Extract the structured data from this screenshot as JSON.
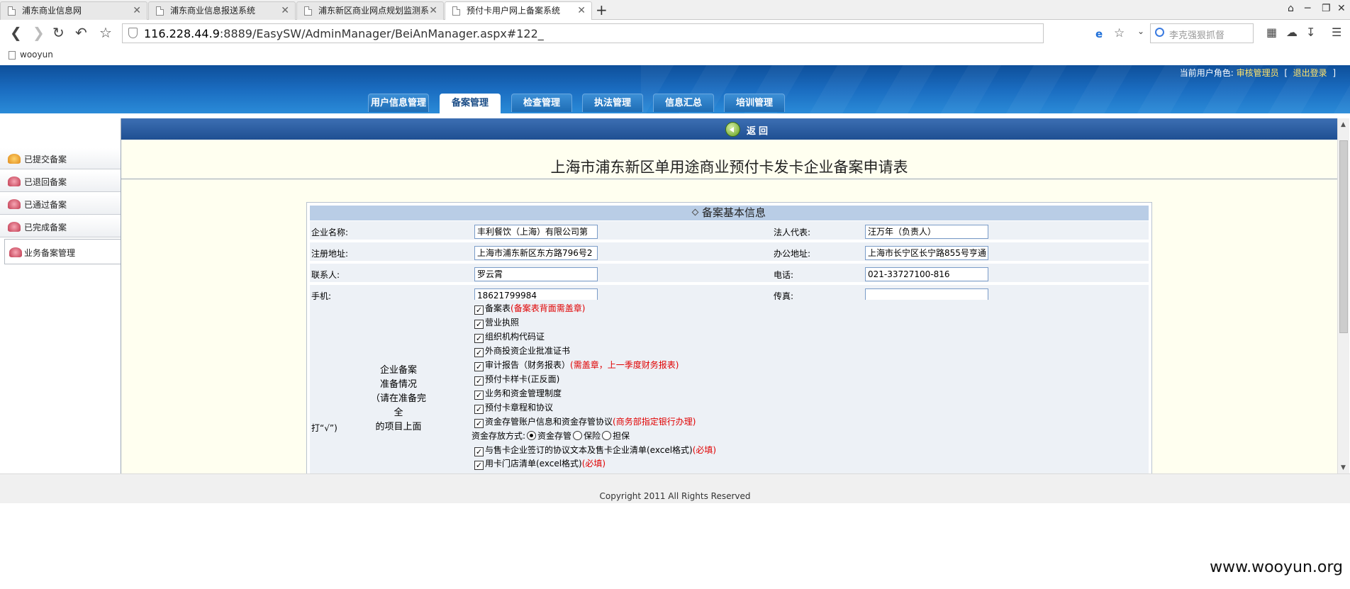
{
  "browser": {
    "tabs": [
      {
        "title": "浦东商业信息网"
      },
      {
        "title": "浦东商业信息报送系统"
      },
      {
        "title": "浦东新区商业网点规划监测系"
      },
      {
        "title": "预付卡用户网上备案系统"
      }
    ],
    "new_tab": "+",
    "url_host": "116.228.44.9",
    "url_rest": ":8889/EasySW/AdminManager/BeiAnManager.aspx#122_",
    "search_placeholder": "李克强狠抓督",
    "bookmark": "wooyun",
    "window_controls": [
      "❯",
      "─",
      "❐",
      "✕"
    ]
  },
  "header": {
    "user_prefix": "当前用户角色:",
    "role": "审核管理员",
    "bracket_open": "[",
    "logout": "退出登录",
    "bracket_close": "]",
    "menu": [
      {
        "label": "用户信息管理"
      },
      {
        "label": "备案管理"
      },
      {
        "label": "检查管理"
      },
      {
        "label": "执法管理"
      },
      {
        "label": "信息汇总"
      },
      {
        "label": "培训管理"
      }
    ]
  },
  "sidebar": {
    "items": [
      {
        "label": "已提交备案"
      },
      {
        "label": "已退回备案"
      },
      {
        "label": "已通过备案"
      },
      {
        "label": "已完成备案"
      },
      {
        "label": "业务备案管理"
      }
    ]
  },
  "main": {
    "back_label": "返回",
    "title": "上海市浦东新区单用途商业预付卡发卡企业备案申请表",
    "section_title": "备案基本信息",
    "fields": {
      "company_label": "企业名称:",
      "company_value": "丰利餐饮（上海）有限公司第",
      "legal_label": "法人代表:",
      "legal_value": "汪万年（负责人）",
      "reg_addr_label": "注册地址:",
      "reg_addr_value": "上海市浦东新区东方路796号2",
      "office_label": "办公地址:",
      "office_value": "上海市长宁区长宁路855号亨通",
      "contact_label": "联系人:",
      "contact_value": "罗云霄",
      "phone_label": "电话:",
      "phone_value": "021-33727100-816",
      "mobile_label": "手机:",
      "mobile_value": "18621799984",
      "fax_label": "传真:",
      "fax_value": ""
    },
    "prep": {
      "label": "企业备案\n准备情况\n（请在准备完全\n的项目上面",
      "tick_hint": "打“√”)",
      "items": [
        {
          "text": "备案表",
          "note": "(备案表背面需盖章)",
          "checked": true
        },
        {
          "text": "营业执照",
          "note": "",
          "checked": true
        },
        {
          "text": "组织机构代码证",
          "note": "",
          "checked": true
        },
        {
          "text": "外商投资企业批准证书",
          "note": "",
          "checked": true
        },
        {
          "text": "审计报告（财务报表）",
          "note": "(需盖章，上一季度财务报表)",
          "checked": true
        },
        {
          "text": "预付卡样卡(正反面)",
          "note": "",
          "checked": true
        },
        {
          "text": "业务和资金管理制度",
          "note": "",
          "checked": true
        },
        {
          "text": "预付卡章程和协议",
          "note": "",
          "checked": true
        },
        {
          "text": "资金存管账户信息和资金存管协议",
          "note": "(商务部指定银行办理)",
          "checked": true
        }
      ],
      "fund_label": "资金存放方式:",
      "fund_options": [
        {
          "label": "资金存管",
          "selected": true
        },
        {
          "label": "保险",
          "selected": false
        },
        {
          "label": "担保",
          "selected": false
        }
      ],
      "items_after": [
        {
          "text": "与售卡企业签订的协议文本及售卡企业清单(excel格式)",
          "note": "(必填)",
          "checked": true
        },
        {
          "text": "用卡门店清单(excel格式)",
          "note": "(必填)",
          "checked": true
        }
      ]
    }
  },
  "footer": {
    "copyright": "Copyright 2011  All Rights Reserved"
  },
  "watermark": "www.wooyun.org"
}
